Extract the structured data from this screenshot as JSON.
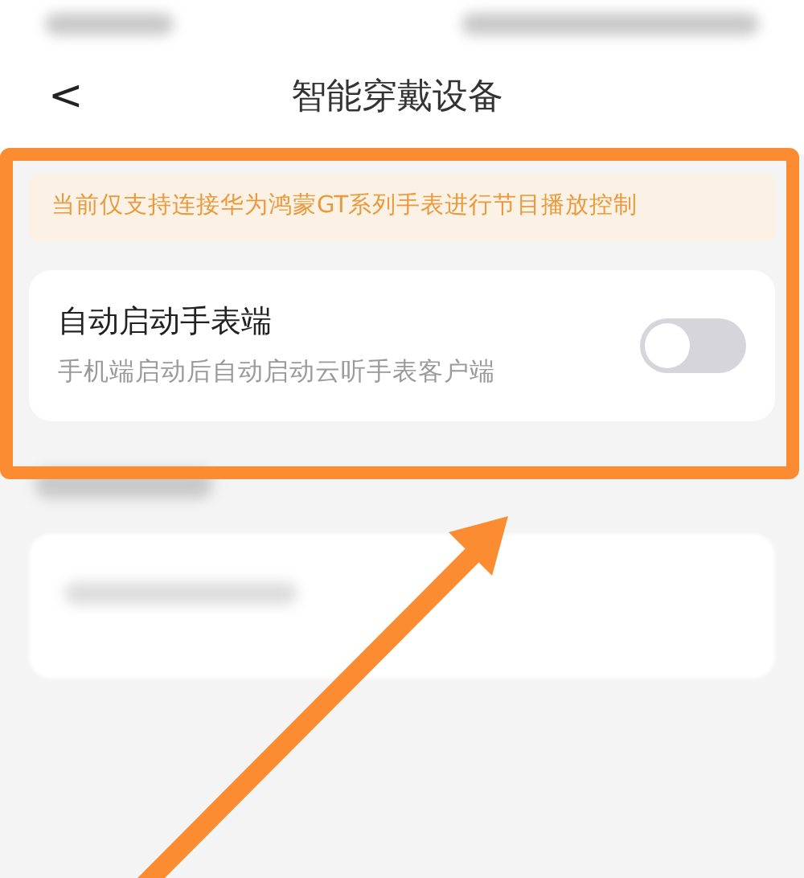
{
  "nav_bar": {
    "back": "<",
    "title": "智能穿戴设备"
  },
  "notice": "当前仅支持连接华为鸿蒙GT系列手表进行节目播放控制",
  "settings": [
    {
      "title": "自动启动手表端",
      "description": "手机端启动后自动启动云听手表客户端",
      "on": false
    }
  ]
}
